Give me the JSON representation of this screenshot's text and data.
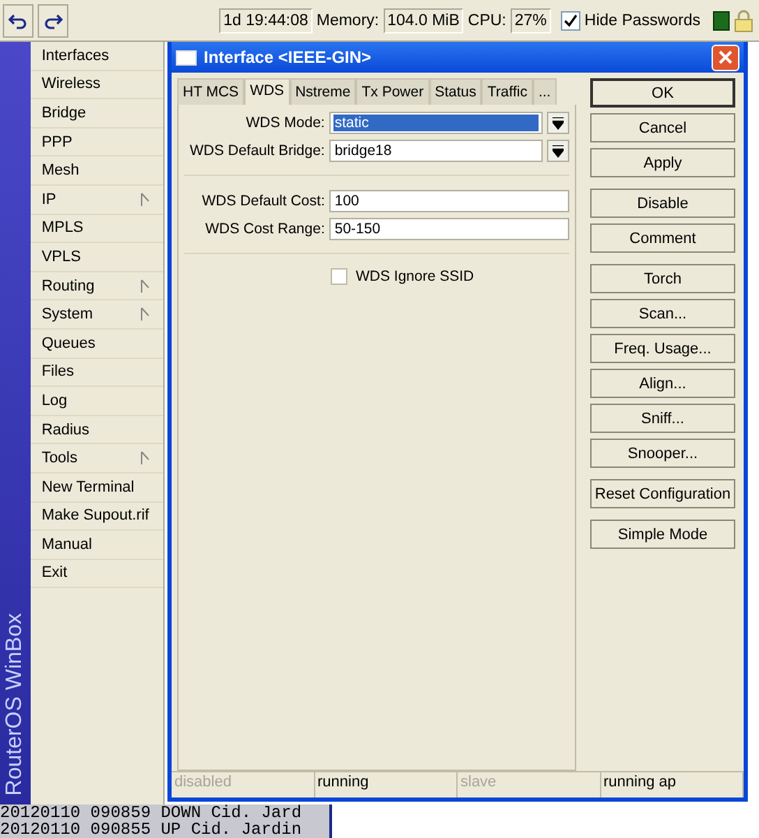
{
  "toolbar": {
    "uptime": "1d 19:44:08",
    "memory_label": "Memory:",
    "memory": "104.0 MiB",
    "cpu_label": "CPU:",
    "cpu": "27%",
    "hide_passwords": {
      "label": "Hide Passwords",
      "checked": true
    }
  },
  "brand": "RouterOS WinBox",
  "menu": [
    {
      "label": "Interfaces",
      "submenu": false
    },
    {
      "label": "Wireless",
      "submenu": false
    },
    {
      "label": "Bridge",
      "submenu": false
    },
    {
      "label": "PPP",
      "submenu": false
    },
    {
      "label": "Mesh",
      "submenu": false
    },
    {
      "label": "IP",
      "submenu": true
    },
    {
      "label": "MPLS",
      "submenu": false
    },
    {
      "label": "VPLS",
      "submenu": false
    },
    {
      "label": "Routing",
      "submenu": true
    },
    {
      "label": "System",
      "submenu": true
    },
    {
      "label": "Queues",
      "submenu": false
    },
    {
      "label": "Files",
      "submenu": false
    },
    {
      "label": "Log",
      "submenu": false
    },
    {
      "label": "Radius",
      "submenu": false
    },
    {
      "label": "Tools",
      "submenu": true
    },
    {
      "label": "New Terminal",
      "submenu": false
    },
    {
      "label": "Make Supout.rif",
      "submenu": false
    },
    {
      "label": "Manual",
      "submenu": false
    },
    {
      "label": "Exit",
      "submenu": false
    }
  ],
  "window": {
    "title": "Interface <IEEE-GIN>",
    "tabs": [
      {
        "label": "HT MCS",
        "selected": false
      },
      {
        "label": "WDS",
        "selected": true
      },
      {
        "label": "Nstreme",
        "selected": false
      },
      {
        "label": "Tx Power",
        "selected": false
      },
      {
        "label": "Status",
        "selected": false
      },
      {
        "label": "Traffic",
        "selected": false
      },
      {
        "label": "...",
        "selected": false
      }
    ],
    "field_groups": [
      [
        {
          "label": "WDS Mode:",
          "value": "static",
          "kind": "select",
          "selected": true
        },
        {
          "label": "WDS Default Bridge:",
          "value": "bridge18",
          "kind": "select",
          "selected": false
        }
      ],
      [
        {
          "label": "WDS Default Cost:",
          "value": "100",
          "kind": "text",
          "selected": false
        },
        {
          "label": "WDS Cost Range:",
          "value": "50-150",
          "kind": "text",
          "selected": false
        }
      ]
    ],
    "checkbox": {
      "label": "WDS Ignore SSID",
      "checked": false
    },
    "button_groups": [
      [
        "OK",
        "Cancel",
        "Apply"
      ],
      [
        "Disable",
        "Comment"
      ],
      [
        "Torch",
        "Scan...",
        "Freq. Usage...",
        "Align...",
        "Sniff...",
        "Snooper..."
      ],
      [
        "Reset Configuration"
      ],
      [
        "Simple Mode"
      ]
    ],
    "status_bar": [
      {
        "text": "disabled",
        "active": false
      },
      {
        "text": "running",
        "active": true
      },
      {
        "text": "slave",
        "active": false
      },
      {
        "text": "running ap",
        "active": true
      }
    ]
  },
  "log": [
    "20120110 090859 DOWN Cid. Jard",
    "20120110 090855 UP Cid. Jardin"
  ]
}
